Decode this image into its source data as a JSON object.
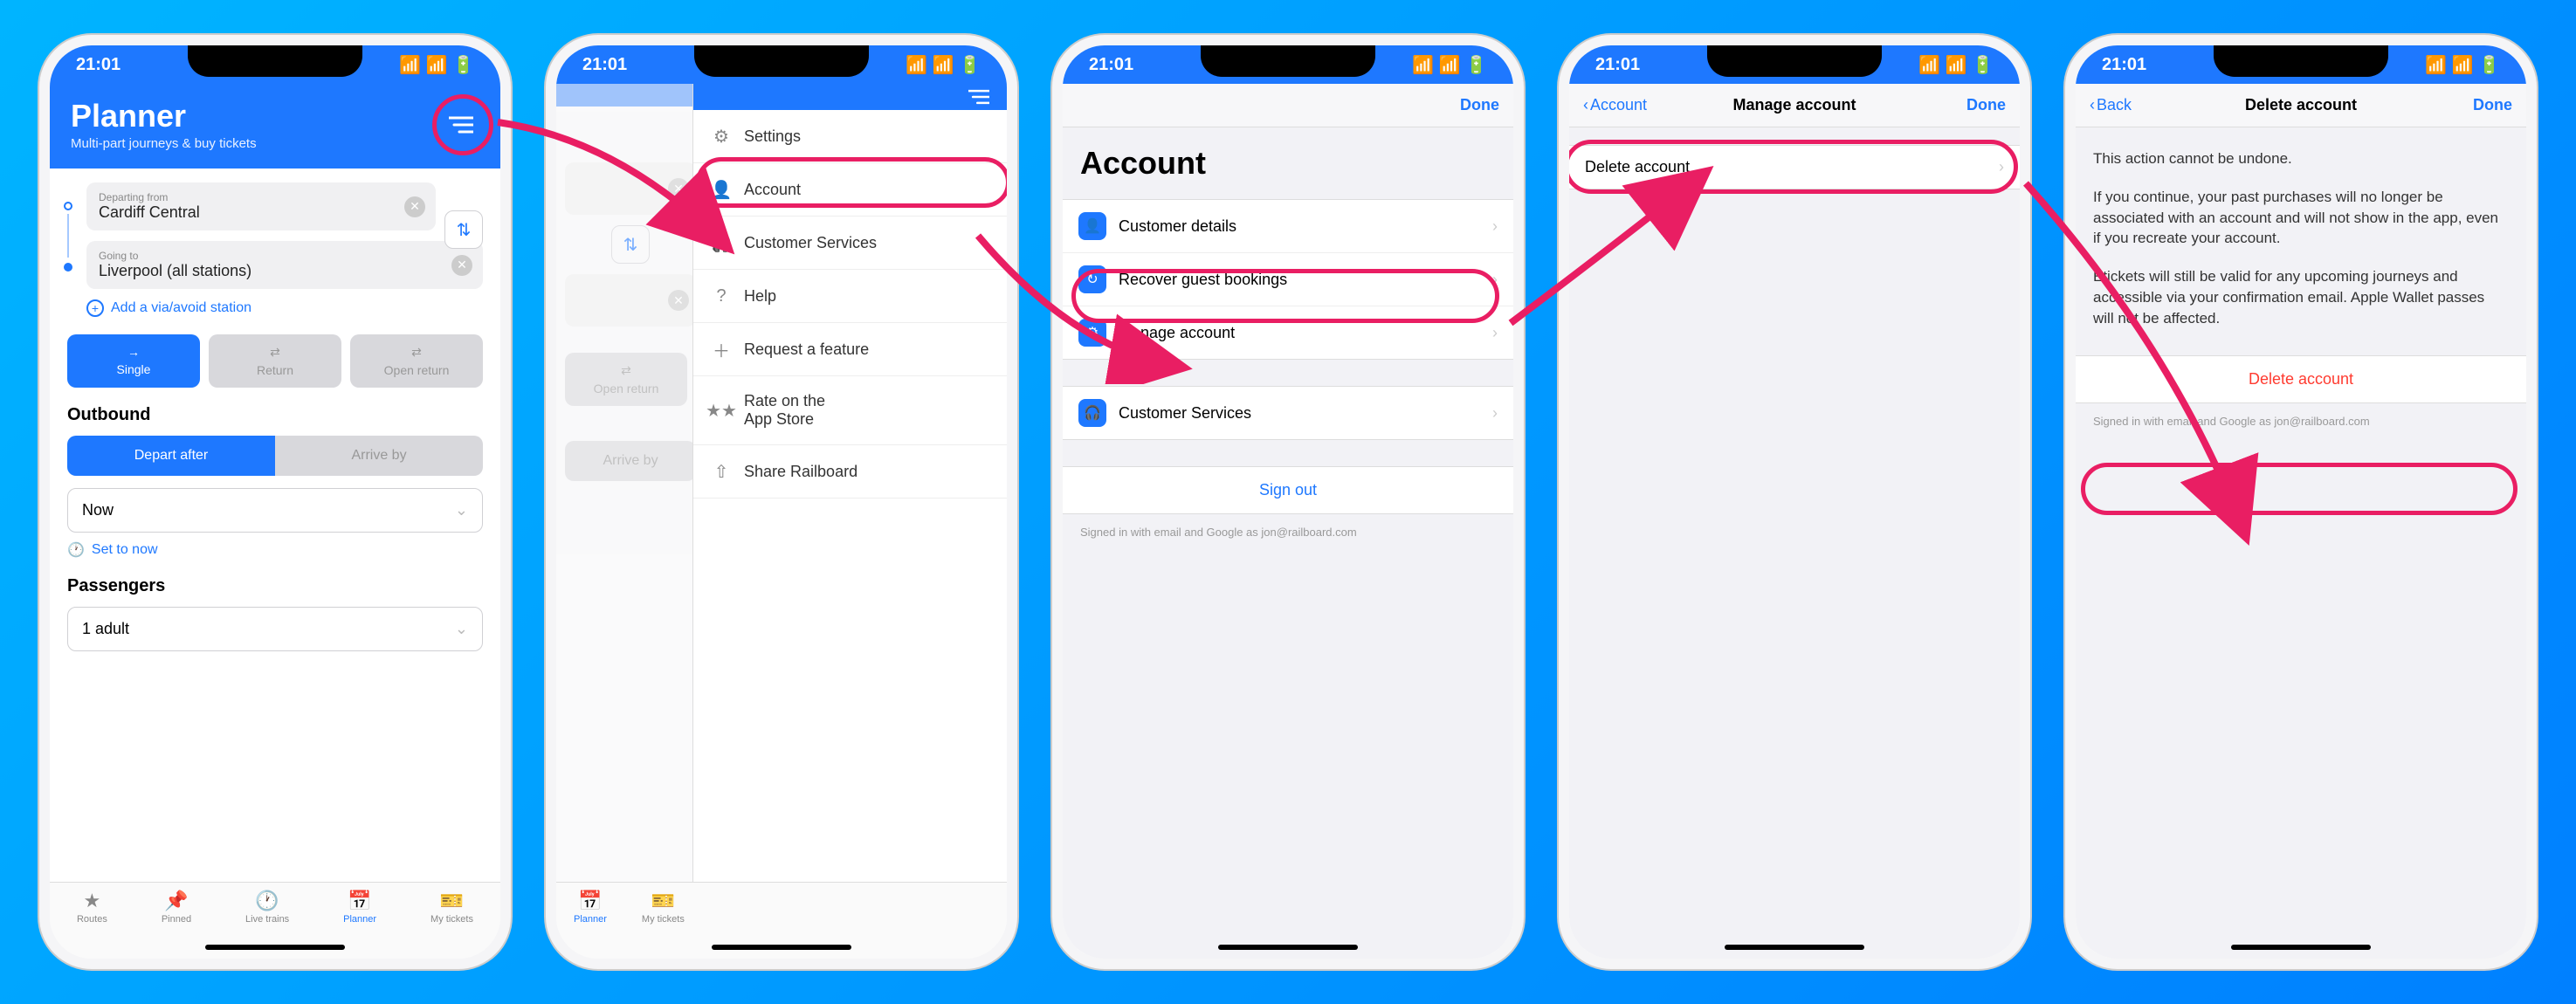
{
  "status_time": "21:01",
  "phone1": {
    "header_title": "Planner",
    "header_sub": "Multi-part journeys & buy tickets",
    "from_label": "Departing from",
    "from_value": "Cardiff Central",
    "to_label": "Going to",
    "to_value": "Liverpool (all stations)",
    "via_link": "Add a via/avoid station",
    "pill_single": "Single",
    "pill_return": "Return",
    "pill_open": "Open return",
    "section_outbound": "Outbound",
    "depart_after": "Depart after",
    "arrive_by": "Arrive by",
    "time_select": "Now",
    "set_now": "Set to now",
    "section_passengers": "Passengers",
    "passengers_value": "1 adult",
    "tabs": {
      "routes": "Routes",
      "pinned": "Pinned",
      "live": "Live trains",
      "planner": "Planner",
      "tickets": "My tickets"
    }
  },
  "phone2": {
    "drawer": {
      "settings": "Settings",
      "account": "Account",
      "customer": "Customer Services",
      "help": "Help",
      "feature": "Request a feature",
      "rate": "Rate on the\nApp Store",
      "share": "Share Railboard"
    },
    "pill_open": "Open return",
    "arrive_by": "Arrive by",
    "tabs": {
      "planner": "Planner",
      "tickets": "My tickets"
    }
  },
  "phone3": {
    "nav_done": "Done",
    "title": "Account",
    "items": {
      "details": "Customer details",
      "recover": "Recover guest bookings",
      "manage": "Manage account",
      "services": "Customer Services"
    },
    "signout": "Sign out",
    "footer": "Signed in with email and Google as jon@railboard.com"
  },
  "phone4": {
    "nav_back": "Account",
    "nav_title": "Manage account",
    "nav_done": "Done",
    "item_delete": "Delete account"
  },
  "phone5": {
    "nav_back": "Back",
    "nav_title": "Delete account",
    "nav_done": "Done",
    "p1": "This action cannot be undone.",
    "p2": "If you continue, your past purchases will no longer be associated with an account and will not show in the app, even if you recreate your account.",
    "p3": "Etickets will still be valid for any upcoming journeys and accessible via your confirmation email. Apple Wallet passes will not be affected.",
    "delete_btn": "Delete account",
    "footer": "Signed in with email and Google as jon@railboard.com"
  }
}
